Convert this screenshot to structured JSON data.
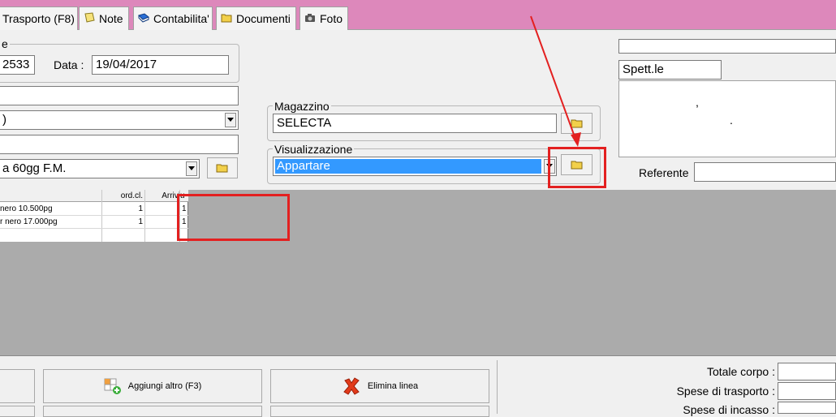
{
  "tabs": [
    {
      "label": "Trasporto (F8)",
      "icon": "none"
    },
    {
      "label": "Note",
      "icon": "note-icon"
    },
    {
      "label": "Contabilita'",
      "icon": "book-icon"
    },
    {
      "label": "Documenti",
      "icon": "folder-icon"
    },
    {
      "label": "Foto",
      "icon": "camera-icon"
    }
  ],
  "header": {
    "group_title_fragment": "e",
    "number_value": "2533",
    "date_label": "Data :",
    "date_value": "19/04/2017",
    "combo1_value": ")",
    "payment_value": "a 60gg F.M."
  },
  "magazzino": {
    "label": "Magazzino",
    "value": "SELECTA"
  },
  "visualizzazione": {
    "label": "Visualizzazione",
    "value": "Appartare"
  },
  "recipient": {
    "salutation": "Spett.le",
    "mark1": ",",
    "mark2": "."
  },
  "referente": {
    "label": "Referente",
    "value": ""
  },
  "grid": {
    "headers": [
      "ord.cl.",
      "Arrivi",
      "u"
    ],
    "rows": [
      {
        "desc": "nero 10.500pg",
        "ord": "1",
        "arr": "",
        "u": "1"
      },
      {
        "desc": "r nero 17.000pg",
        "ord": "1",
        "arr": "",
        "u": "1"
      },
      {
        "desc": "",
        "ord": "",
        "arr": "",
        "u": ""
      }
    ]
  },
  "actions": {
    "add_other": "Aggiungi altro (F3)",
    "delete_line": "Elimina linea"
  },
  "totals": {
    "totale_corpo": "Totale corpo :",
    "spese_trasporto": "Spese di trasporto :",
    "spese_incasso": "Spese di incasso :"
  },
  "colors": {
    "tabstrip": "#dd88bb",
    "selection": "#3399ff",
    "annotation": "#e32020"
  }
}
